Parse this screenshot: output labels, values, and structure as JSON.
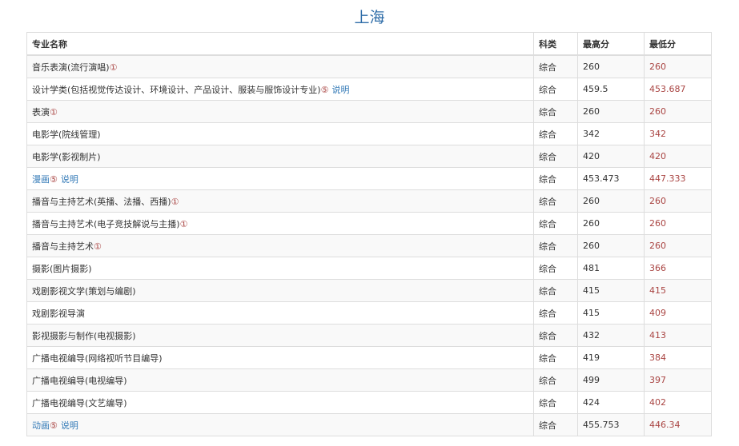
{
  "title": "上海",
  "table": {
    "headers": {
      "name": "专业名称",
      "type": "科类",
      "high": "最高分",
      "low": "最低分"
    },
    "rows": [
      {
        "name": "音乐表演(流行演唱)",
        "mark": "①",
        "explain": "",
        "type": "综合",
        "high": "260",
        "low": "260"
      },
      {
        "name": "设计学类(包括视觉传达设计、环境设计、产品设计、服装与服饰设计专业)",
        "mark": "⑤",
        "explain": "说明",
        "type": "综合",
        "high": "459.5",
        "low": "453.687"
      },
      {
        "name": "表演",
        "mark": "①",
        "explain": "",
        "type": "综合",
        "high": "260",
        "low": "260"
      },
      {
        "name": "电影学(院线管理)",
        "mark": "",
        "explain": "",
        "type": "综合",
        "high": "342",
        "low": "342"
      },
      {
        "name": "电影学(影视制片)",
        "mark": "",
        "explain": "",
        "type": "综合",
        "high": "420",
        "low": "420"
      },
      {
        "name": "漫画",
        "mark": "⑤",
        "explain": "说明",
        "type": "综合",
        "high": "453.473",
        "low": "447.333",
        "link": true
      },
      {
        "name": "播音与主持艺术(英播、法播、西播)",
        "mark": "①",
        "explain": "",
        "type": "综合",
        "high": "260",
        "low": "260"
      },
      {
        "name": "播音与主持艺术(电子竞技解说与主播)",
        "mark": "①",
        "explain": "",
        "type": "综合",
        "high": "260",
        "low": "260"
      },
      {
        "name": "播音与主持艺术",
        "mark": "①",
        "explain": "",
        "type": "综合",
        "high": "260",
        "low": "260"
      },
      {
        "name": "摄影(图片摄影)",
        "mark": "",
        "explain": "",
        "type": "综合",
        "high": "481",
        "low": "366"
      },
      {
        "name": "戏剧影视文学(策划与编剧)",
        "mark": "",
        "explain": "",
        "type": "综合",
        "high": "415",
        "low": "415"
      },
      {
        "name": "戏剧影视导演",
        "mark": "",
        "explain": "",
        "type": "综合",
        "high": "415",
        "low": "409"
      },
      {
        "name": "影视摄影与制作(电视摄影)",
        "mark": "",
        "explain": "",
        "type": "综合",
        "high": "432",
        "low": "413"
      },
      {
        "name": "广播电视编导(网络视听节目编导)",
        "mark": "",
        "explain": "",
        "type": "综合",
        "high": "419",
        "low": "384"
      },
      {
        "name": "广播电视编导(电视编导)",
        "mark": "",
        "explain": "",
        "type": "综合",
        "high": "499",
        "low": "397"
      },
      {
        "name": "广播电视编导(文艺编导)",
        "mark": "",
        "explain": "",
        "type": "综合",
        "high": "424",
        "low": "402"
      },
      {
        "name": "动画",
        "mark": "⑤",
        "explain": "说明",
        "type": "综合",
        "high": "455.753",
        "low": "446.34",
        "link": true
      }
    ]
  },
  "colors": {
    "title": "#2f6da8",
    "low_score": "#a94442",
    "link": "#337ab7"
  }
}
